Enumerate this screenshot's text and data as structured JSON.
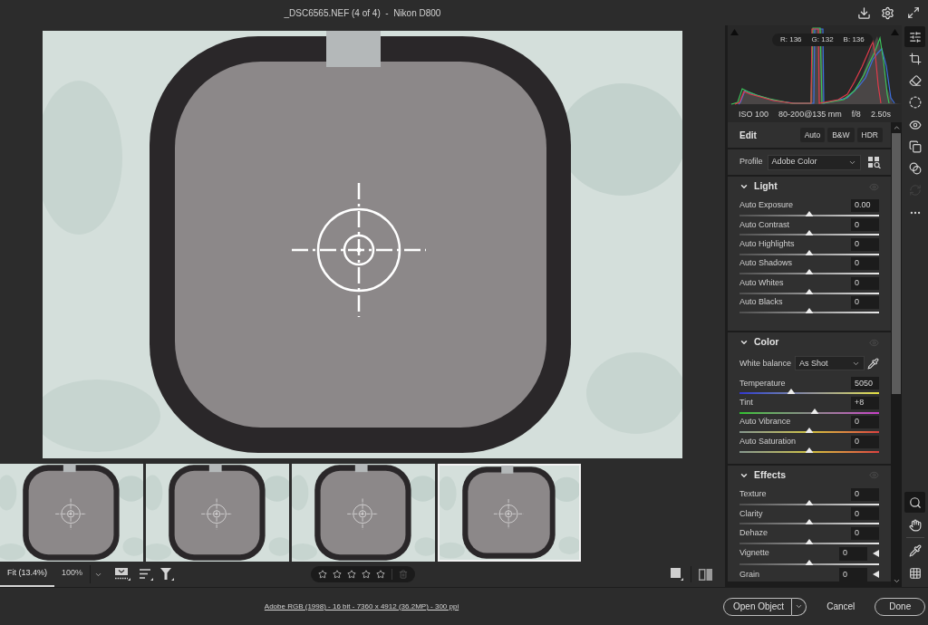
{
  "title_bar": {
    "title": "_DSC6565.NEF (4 of 4)  -  Nikon D800"
  },
  "filmstrip": [
    {
      "selected": false
    },
    {
      "selected": false
    },
    {
      "selected": false
    },
    {
      "selected": true
    }
  ],
  "filmstrip_toolbar": {
    "zoom_options": [
      {
        "label": "Fit (13.4%)",
        "selected": true
      },
      {
        "label": "100%",
        "selected": false
      }
    ],
    "rating": {
      "stars": 0
    }
  },
  "histogram": {
    "readout": [
      "R: 136",
      "G: 132",
      "B: 136"
    ],
    "exif": [
      "ISO 100",
      "80-200@135 mm",
      "f/8",
      "2.50s"
    ]
  },
  "edit_panel": {
    "title": "Edit",
    "buttons": [
      "Auto",
      "B&W",
      "HDR"
    ],
    "profile": {
      "label": "Profile",
      "value": "Adobe Color"
    },
    "sections": [
      {
        "title": "Light",
        "expanded": true,
        "rows": [
          {
            "label": "Auto Exposure",
            "value": "0.00",
            "kind": "neutral",
            "level": 0.5,
            "expandable": false
          },
          {
            "label": "Auto Contrast",
            "value": "0",
            "kind": "neutral",
            "level": 0.5,
            "expandable": false
          },
          {
            "label": "Auto Highlights",
            "value": "0",
            "kind": "neutral",
            "level": 0.5,
            "expandable": false
          },
          {
            "label": "Auto Shadows",
            "value": "0",
            "kind": "neutral",
            "level": 0.5,
            "expandable": false
          },
          {
            "label": "Auto Whites",
            "value": "0",
            "kind": "neutral",
            "level": 0.5,
            "expandable": false
          },
          {
            "label": "Auto Blacks",
            "value": "0",
            "kind": "neutral",
            "level": 0.5,
            "expandable": false
          }
        ]
      },
      {
        "title": "Color",
        "expanded": true,
        "white_balance": {
          "label": "White balance",
          "value": "As Shot"
        },
        "rows": [
          {
            "label": "Temperature",
            "value": "5050",
            "kind": "temperature",
            "level": 0.37,
            "expandable": false
          },
          {
            "label": "Tint",
            "value": "+8",
            "kind": "tint",
            "level": 0.54,
            "expandable": false
          },
          {
            "label": "Auto Vibrance",
            "value": "0",
            "kind": "saturation",
            "level": 0.5,
            "expandable": false
          },
          {
            "label": "Auto Saturation",
            "value": "0",
            "kind": "saturation",
            "level": 0.5,
            "expandable": false
          }
        ]
      },
      {
        "title": "Effects",
        "expanded": true,
        "rows": [
          {
            "label": "Texture",
            "value": "0",
            "kind": "neutral",
            "level": 0.5,
            "expandable": false
          },
          {
            "label": "Clarity",
            "value": "0",
            "kind": "neutral",
            "level": 0.5,
            "expandable": false
          },
          {
            "label": "Dehaze",
            "value": "0",
            "kind": "neutral",
            "level": 0.5,
            "expandable": false
          },
          {
            "label": "Vignette",
            "value": "0",
            "kind": "neutral",
            "level": 0.5,
            "expandable": true
          },
          {
            "label": "Grain",
            "value": "0",
            "expandable": true
          }
        ]
      }
    ]
  },
  "tools": [
    {
      "kind": "edit",
      "selected": true,
      "disabled": false
    },
    {
      "kind": "crop",
      "selected": false,
      "disabled": false
    },
    {
      "kind": "heal",
      "selected": false,
      "disabled": false
    },
    {
      "kind": "mask",
      "selected": false,
      "disabled": false
    },
    {
      "kind": "redeye",
      "selected": false,
      "disabled": false
    },
    {
      "kind": "presets",
      "selected": false,
      "disabled": false
    },
    {
      "kind": "snapshots",
      "selected": false,
      "disabled": false
    },
    {
      "kind": "refresh",
      "selected": false,
      "disabled": true
    },
    {
      "kind": "more",
      "selected": false,
      "disabled": false
    }
  ],
  "view_tools": [
    {
      "kind": "zoom",
      "selected": true
    },
    {
      "kind": "hand",
      "selected": false
    },
    {
      "kind": "sampler",
      "selected": false
    },
    {
      "kind": "grid",
      "selected": false
    }
  ],
  "footer": {
    "image_info": "Adobe RGB (1998) - 16 bit - 7360 x 4912 (36.2MP) - 300 ppi",
    "buttons": [
      {
        "kind": "split",
        "label": "Open Object"
      },
      {
        "kind": "plain",
        "label": "Cancel"
      },
      {
        "kind": "outline",
        "label": "Done"
      }
    ]
  }
}
